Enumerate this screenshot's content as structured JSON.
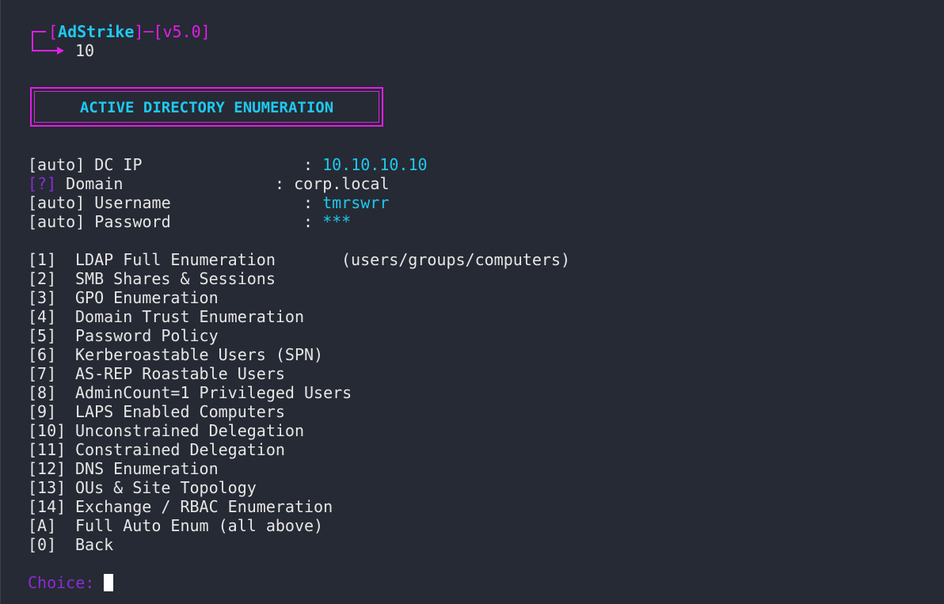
{
  "prompt": {
    "bracket_open": "[",
    "app_name": "AdStrike",
    "bracket_close": "]",
    "dash": "─",
    "version": "[v5.0]",
    "input": "10"
  },
  "banner": {
    "title": "ACTIVE DIRECTORY ENUMERATION"
  },
  "config": [
    {
      "tag": "[auto]",
      "label": " DC IP",
      "sep": ": ",
      "value": "10.10.10.10"
    },
    {
      "tag": "[?]",
      "label": " Domain",
      "sep": ": ",
      "value": "corp.local"
    },
    {
      "tag": "[auto]",
      "label": " Username",
      "sep": ": ",
      "value": "tmrswrr"
    },
    {
      "tag": "[auto]",
      "label": " Password",
      "sep": ": ",
      "value": "***"
    }
  ],
  "menu": [
    {
      "key": "[1]",
      "label": "LDAP Full Enumeration",
      "note": "(users/groups/computers)"
    },
    {
      "key": "[2]",
      "label": "SMB Shares & Sessions",
      "note": ""
    },
    {
      "key": "[3]",
      "label": "GPO Enumeration",
      "note": ""
    },
    {
      "key": "[4]",
      "label": "Domain Trust Enumeration",
      "note": ""
    },
    {
      "key": "[5]",
      "label": "Password Policy",
      "note": ""
    },
    {
      "key": "[6]",
      "label": "Kerberoastable Users (SPN)",
      "note": ""
    },
    {
      "key": "[7]",
      "label": "AS-REP Roastable Users",
      "note": ""
    },
    {
      "key": "[8]",
      "label": "AdminCount=1 Privileged Users",
      "note": ""
    },
    {
      "key": "[9]",
      "label": "LAPS Enabled Computers",
      "note": ""
    },
    {
      "key": "[10]",
      "label": "Unconstrained Delegation",
      "note": ""
    },
    {
      "key": "[11]",
      "label": "Constrained Delegation",
      "note": ""
    },
    {
      "key": "[12]",
      "label": "DNS Enumeration",
      "note": ""
    },
    {
      "key": "[13]",
      "label": "OUs & Site Topology",
      "note": ""
    },
    {
      "key": "[14]",
      "label": "Exchange / RBAC Enumeration",
      "note": ""
    },
    {
      "key": "[A]",
      "label": "Full Auto Enum (all above)",
      "note": ""
    },
    {
      "key": "[0]",
      "label": "Back",
      "note": ""
    }
  ],
  "choice_prompt": "Choice: ",
  "colors": {
    "background": "#262a34",
    "accent_magenta": "#e21ee8",
    "accent_cyan": "#1fc8f0",
    "prompt_purple": "#8a2bd6",
    "text": "#e6e6e6"
  }
}
